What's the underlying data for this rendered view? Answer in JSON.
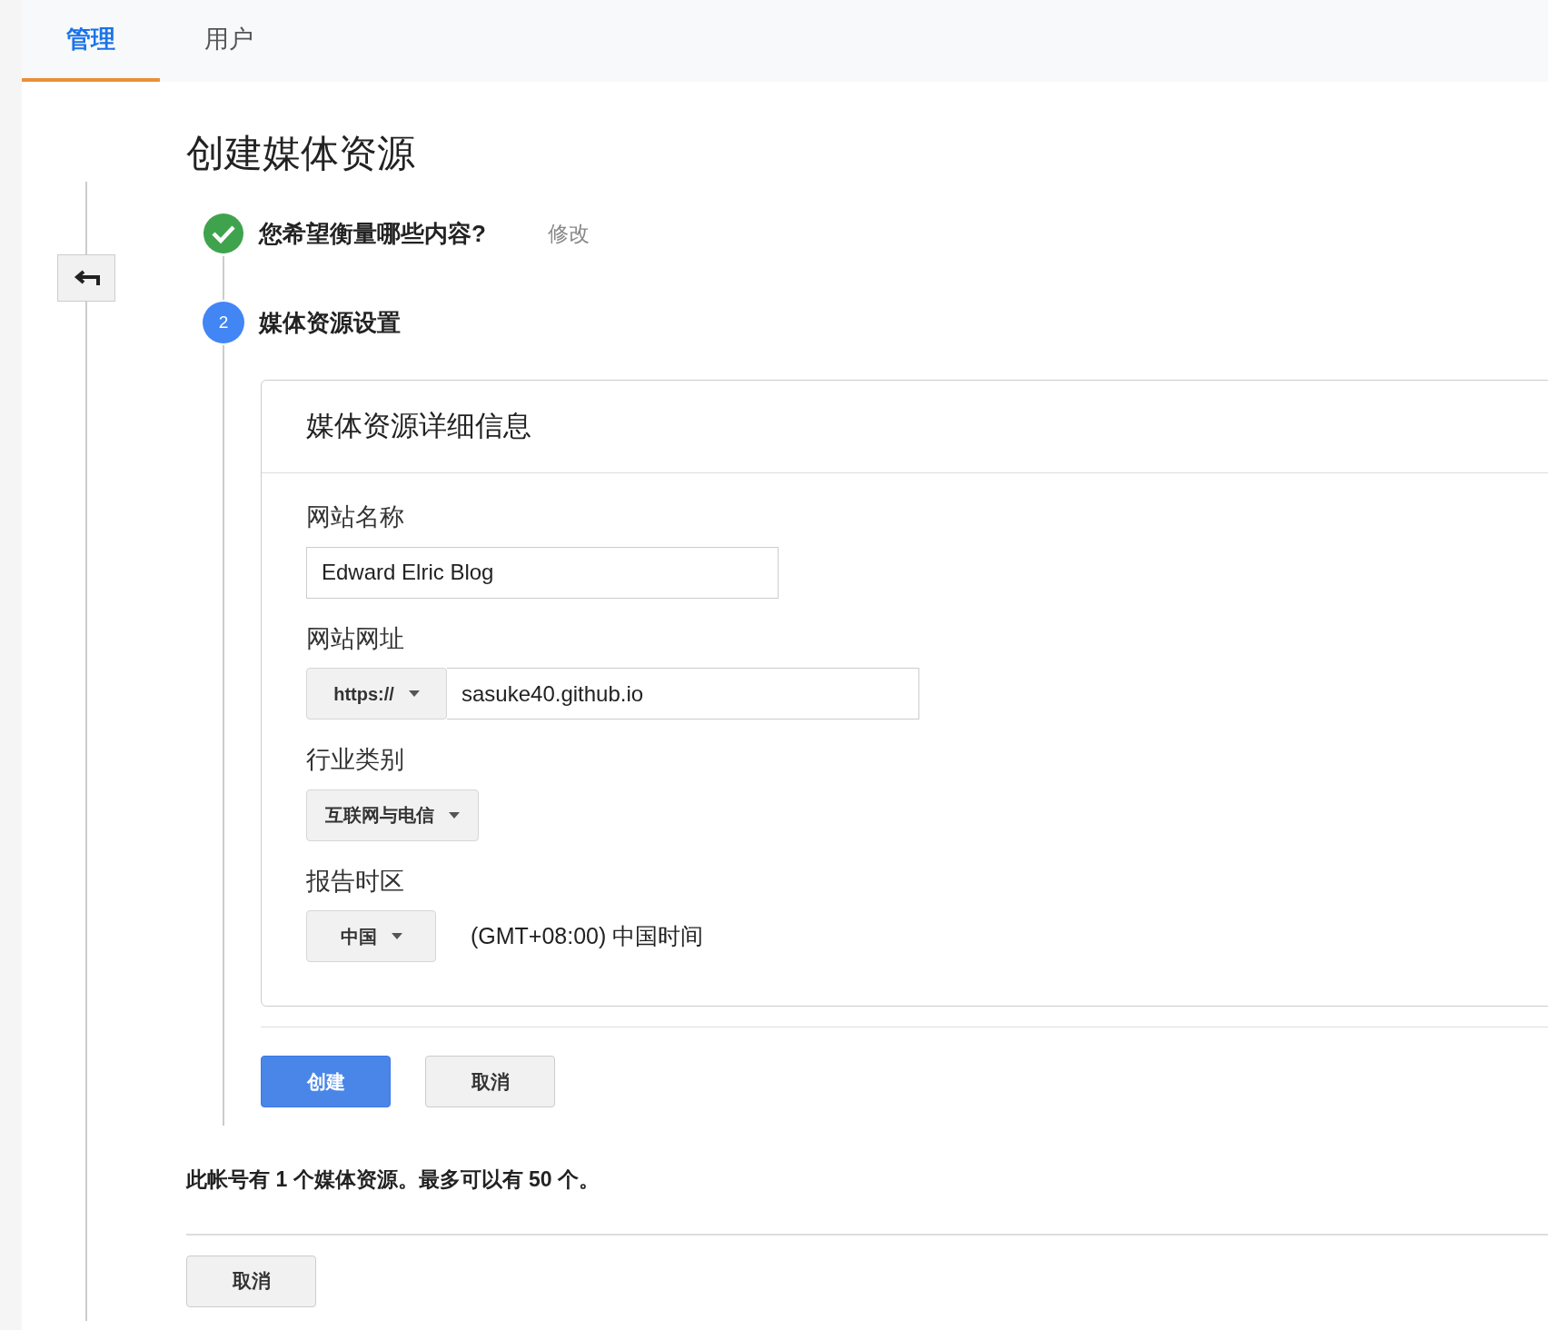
{
  "tabs": [
    {
      "label": "管理",
      "selected": true
    },
    {
      "label": "用户",
      "selected": false
    }
  ],
  "title": "创建媒体资源",
  "steps": [
    {
      "label": "您希望衡量哪些内容?",
      "done": true,
      "action": "修改"
    },
    {
      "number": "2",
      "label": "媒体资源设置",
      "done": false
    }
  ],
  "card": {
    "title": "媒体资源详细信息",
    "site_name": {
      "label": "网站名称",
      "value": "Edward Elric Blog"
    },
    "site_url": {
      "label": "网站网址",
      "protocol": "https://",
      "value": "sasuke40.github.io"
    },
    "industry": {
      "label": "行业类别",
      "value": "互联网与电信"
    },
    "timezone": {
      "label": "报告时区",
      "country": "中国",
      "value": "(GMT+08:00) 中国时间"
    }
  },
  "buttons": [
    {
      "label": "创建",
      "kind": "primary"
    },
    {
      "label": "取消",
      "kind": "secondary"
    }
  ],
  "note": "此帐号有 **1** 个媒体资源。最多可以有 **50** 个。",
  "footer_button": "取消"
}
